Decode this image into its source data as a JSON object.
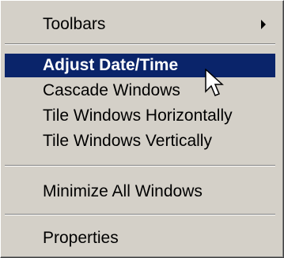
{
  "menu": {
    "items": [
      {
        "label": "Toolbars",
        "has_submenu": true
      },
      {
        "label": "Adjust Date/Time",
        "highlighted": true
      },
      {
        "label": "Cascade Windows"
      },
      {
        "label": "Tile Windows Horizontally"
      },
      {
        "label": "Tile Windows Vertically"
      },
      {
        "label": "Minimize All Windows"
      },
      {
        "label": "Properties"
      }
    ]
  },
  "colors": {
    "menu_background": "#d4d0c8",
    "highlight_background": "#0a246a",
    "highlight_text": "#ffffff",
    "text": "#000000"
  },
  "icons": {
    "submenu_arrow": "submenu-arrow-icon",
    "cursor": "mouse-pointer-icon"
  }
}
